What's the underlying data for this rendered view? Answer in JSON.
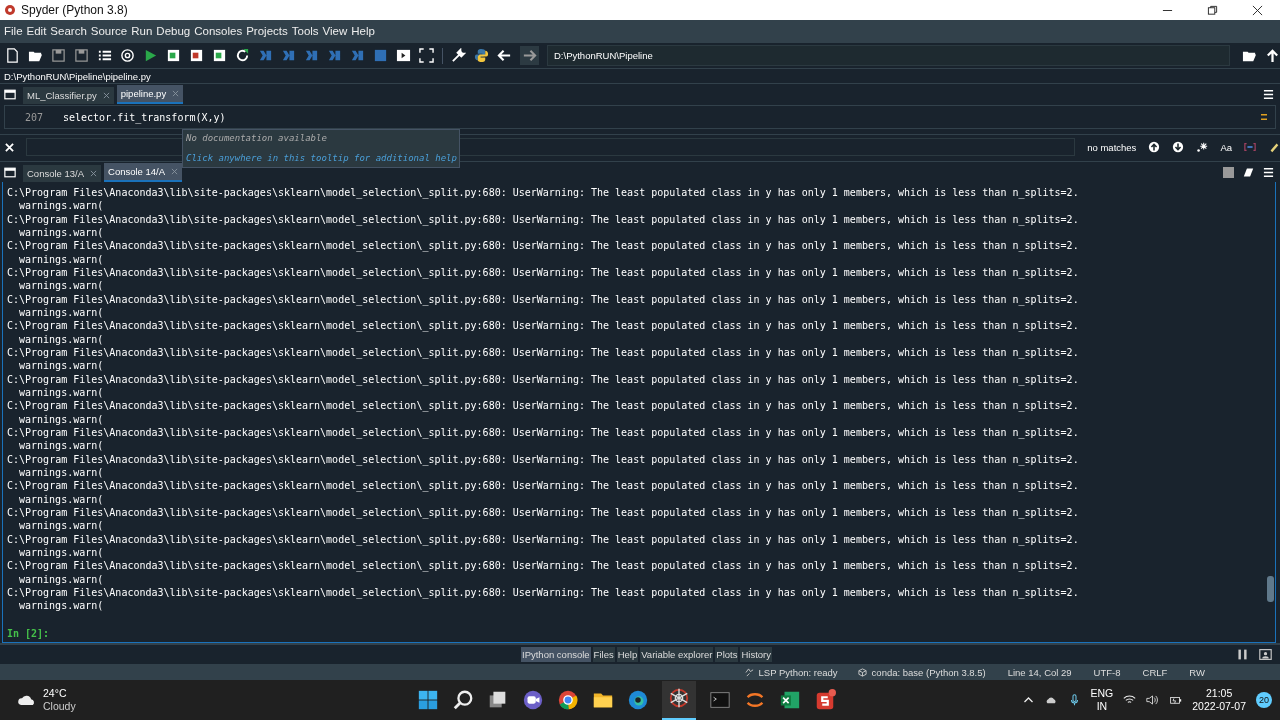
{
  "window": {
    "title": "Spyder (Python 3.8)"
  },
  "menu": [
    "File",
    "Edit",
    "Search",
    "Source",
    "Run",
    "Debug",
    "Consoles",
    "Projects",
    "Tools",
    "View",
    "Help"
  ],
  "toolbar": {
    "path": "D:\\PythonRUN\\Pipeline"
  },
  "editor": {
    "file_path": "D:\\PythonRUN\\Pipeline\\pipeline.py",
    "tabs": [
      {
        "label": "ML_Classifier.py",
        "selected": false
      },
      {
        "label": "pipeline.py",
        "selected": true
      }
    ],
    "line_number": "207",
    "code": "selector.fit_transform(X,y)",
    "tooltip": {
      "title": "No documentation available",
      "hint": "Click anywhere in this tooltip for additional help"
    },
    "find": {
      "status": "no matches",
      "case_label": "Aa"
    }
  },
  "console": {
    "tabs": [
      {
        "label": "Console 13/A",
        "selected": false
      },
      {
        "label": "Console 14/A",
        "selected": true
      }
    ],
    "lines": [
      {
        "warning": "C:\\Program Files\\Anaconda3\\lib\\site-packages\\sklearn\\model_selection\\_split.py:680: UserWarning: The least populated class in y has only 1 members, which is less than n_splits=2.",
        "call": "warnings.warn("
      },
      {
        "warning": "C:\\Program Files\\Anaconda3\\lib\\site-packages\\sklearn\\model_selection\\_split.py:680: UserWarning: The least populated class in y has only 1 members, which is less than n_splits=2.",
        "call": "warnings.warn("
      },
      {
        "warning": "C:\\Program Files\\Anaconda3\\lib\\site-packages\\sklearn\\model_selection\\_split.py:680: UserWarning: The least populated class in y has only 1 members, which is less than n_splits=2.",
        "call": "warnings.warn("
      },
      {
        "warning": "C:\\Program Files\\Anaconda3\\lib\\site-packages\\sklearn\\model_selection\\_split.py:680: UserWarning: The least populated class in y has only 1 members, which is less than n_splits=2.",
        "call": "warnings.warn("
      },
      {
        "warning": "C:\\Program Files\\Anaconda3\\lib\\site-packages\\sklearn\\model_selection\\_split.py:680: UserWarning: The least populated class in y has only 1 members, which is less than n_splits=2.",
        "call": "warnings.warn("
      },
      {
        "warning": "C:\\Program Files\\Anaconda3\\lib\\site-packages\\sklearn\\model_selection\\_split.py:680: UserWarning: The least populated class in y has only 1 members, which is less than n_splits=2.",
        "call": "warnings.warn("
      },
      {
        "warning": "C:\\Program Files\\Anaconda3\\lib\\site-packages\\sklearn\\model_selection\\_split.py:680: UserWarning: The least populated class in y has only 1 members, which is less than n_splits=2.",
        "call": "warnings.warn("
      },
      {
        "warning": "C:\\Program Files\\Anaconda3\\lib\\site-packages\\sklearn\\model_selection\\_split.py:680: UserWarning: The least populated class in y has only 1 members, which is less than n_splits=2.",
        "call": "warnings.warn("
      },
      {
        "warning": "C:\\Program Files\\Anaconda3\\lib\\site-packages\\sklearn\\model_selection\\_split.py:680: UserWarning: The least populated class in y has only 1 members, which is less than n_splits=2.",
        "call": "warnings.warn("
      },
      {
        "warning": "C:\\Program Files\\Anaconda3\\lib\\site-packages\\sklearn\\model_selection\\_split.py:680: UserWarning: The least populated class in y has only 1 members, which is less than n_splits=2.",
        "call": "warnings.warn("
      },
      {
        "warning": "C:\\Program Files\\Anaconda3\\lib\\site-packages\\sklearn\\model_selection\\_split.py:680: UserWarning: The least populated class in y has only 1 members, which is less than n_splits=2.",
        "call": "warnings.warn("
      },
      {
        "warning": "C:\\Program Files\\Anaconda3\\lib\\site-packages\\sklearn\\model_selection\\_split.py:680: UserWarning: The least populated class in y has only 1 members, which is less than n_splits=2.",
        "call": "warnings.warn("
      },
      {
        "warning": "C:\\Program Files\\Anaconda3\\lib\\site-packages\\sklearn\\model_selection\\_split.py:680: UserWarning: The least populated class in y has only 1 members, which is less than n_splits=2.",
        "call": "warnings.warn("
      },
      {
        "warning": "C:\\Program Files\\Anaconda3\\lib\\site-packages\\sklearn\\model_selection\\_split.py:680: UserWarning: The least populated class in y has only 1 members, which is less than n_splits=2.",
        "call": "warnings.warn("
      },
      {
        "warning": "C:\\Program Files\\Anaconda3\\lib\\site-packages\\sklearn\\model_selection\\_split.py:680: UserWarning: The least populated class in y has only 1 members, which is less than n_splits=2.",
        "call": "warnings.warn("
      },
      {
        "warning": "C:\\Program Files\\Anaconda3\\lib\\site-packages\\sklearn\\model_selection\\_split.py:680: UserWarning: The least populated class in y has only 1 members, which is less than n_splits=2.",
        "call": "warnings.warn("
      }
    ],
    "prompt": "In [2]:"
  },
  "pane_tabs": [
    {
      "label": "IPython console",
      "selected": true
    },
    {
      "label": "Files",
      "selected": false
    },
    {
      "label": "Help",
      "selected": false
    },
    {
      "label": "Variable explorer",
      "selected": false
    },
    {
      "label": "Plots",
      "selected": false
    },
    {
      "label": "History",
      "selected": false
    }
  ],
  "status_bar": {
    "lsp": "LSP Python: ready",
    "conda": "conda: base (Python 3.8.5)",
    "position": "Line 14, Col 29",
    "encoding": "UTF-8",
    "eol": "CRLF",
    "mode": "RW"
  },
  "taskbar": {
    "temperature": "24°C",
    "weather": "Cloudy",
    "language": "ENG",
    "region": "IN",
    "time": "21:05",
    "date": "2022-07-07",
    "notifications": "20"
  }
}
